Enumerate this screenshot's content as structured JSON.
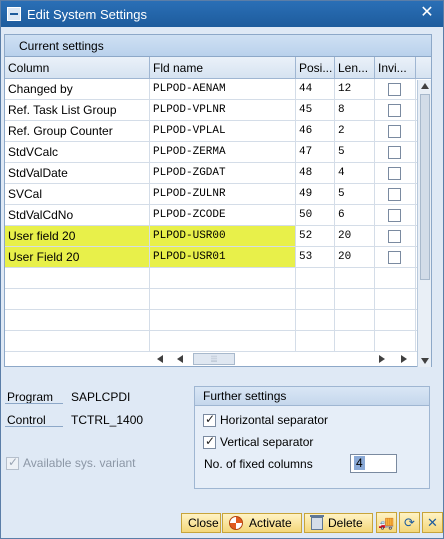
{
  "window": {
    "title": "Edit System Settings"
  },
  "table": {
    "title": "Current settings",
    "columns": [
      "Column",
      "Fld name",
      "Posi...",
      "Len...",
      "Invi..."
    ],
    "rows": [
      {
        "column": "Changed by",
        "fld": "PLPOD-AENAM",
        "pos": "44",
        "len": "12",
        "invisible": false,
        "highlight": false
      },
      {
        "column": "Ref. Task List Group",
        "fld": "PLPOD-VPLNR",
        "pos": "45",
        "len": "8",
        "invisible": false,
        "highlight": false
      },
      {
        "column": "Ref. Group Counter",
        "fld": "PLPOD-VPLAL",
        "pos": "46",
        "len": "2",
        "invisible": false,
        "highlight": false
      },
      {
        "column": "StdVCalc",
        "fld": "PLPOD-ZERMA",
        "pos": "47",
        "len": "5",
        "invisible": false,
        "highlight": false
      },
      {
        "column": "StdValDate",
        "fld": "PLPOD-ZGDAT",
        "pos": "48",
        "len": "4",
        "invisible": false,
        "highlight": false
      },
      {
        "column": "SVCal",
        "fld": "PLPOD-ZULNR",
        "pos": "49",
        "len": "5",
        "invisible": false,
        "highlight": false
      },
      {
        "column": "StdValCdNo",
        "fld": "PLPOD-ZCODE",
        "pos": "50",
        "len": "6",
        "invisible": false,
        "highlight": false
      },
      {
        "column": "User field 20",
        "fld": "PLPOD-USR00",
        "pos": "52",
        "len": "20",
        "invisible": false,
        "highlight": true
      },
      {
        "column": "User Field 20",
        "fld": "PLPOD-USR01",
        "pos": "53",
        "len": "20",
        "invisible": false,
        "highlight": true
      }
    ]
  },
  "info": {
    "program_label": "Program",
    "program_value": "SAPLCPDI",
    "control_label": "Control",
    "control_value": "TCTRL_1400"
  },
  "further": {
    "title": "Further settings",
    "horizontal_label": "Horizontal separator",
    "horizontal_checked": true,
    "vertical_label": "Vertical separator",
    "vertical_checked": true,
    "fixed_label": "No. of fixed columns",
    "fixed_value": "4"
  },
  "available": {
    "label": "Available sys. variant",
    "checked": true
  },
  "buttons": {
    "close": "Close",
    "activate": "Activate",
    "delete": "Delete"
  },
  "colors": {
    "highlight": "#e8f04a",
    "titlebar": "#2a6fb6"
  }
}
